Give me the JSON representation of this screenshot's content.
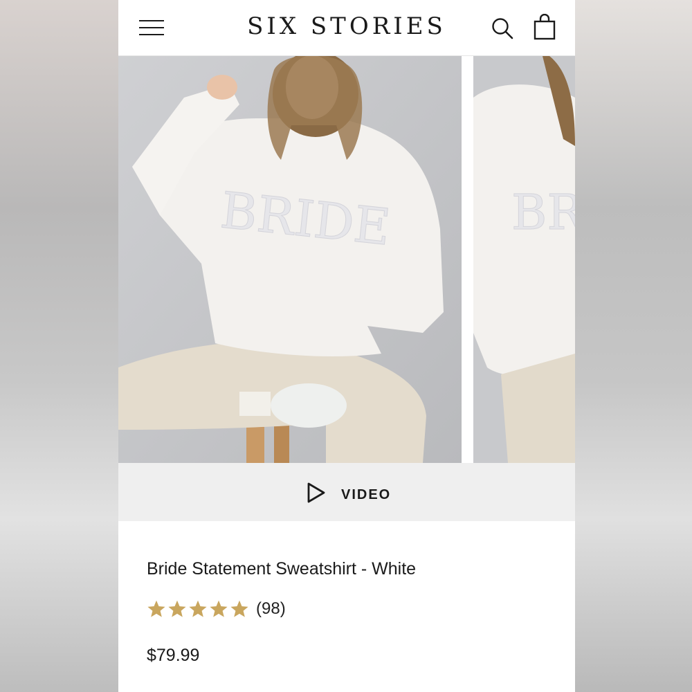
{
  "header": {
    "logo": "SIX STORIES",
    "menu_icon": "hamburger-menu-icon",
    "search_icon": "search-icon",
    "cart_icon": "shopping-bag-icon"
  },
  "gallery": {
    "images": [
      "woman seated on stool wearing white BRIDE sweatshirt",
      "side view of white BRIDE sweatshirt"
    ]
  },
  "video": {
    "label": "VIDEO",
    "icon": "play-icon"
  },
  "product": {
    "title": "Bride Statement Sweatshirt - White",
    "rating": 5,
    "rating_count": "(98)",
    "price": "$79.99"
  },
  "colors": {
    "star": "#c9a65e",
    "text": "#1a1a1a",
    "video_bar": "#efefef"
  }
}
